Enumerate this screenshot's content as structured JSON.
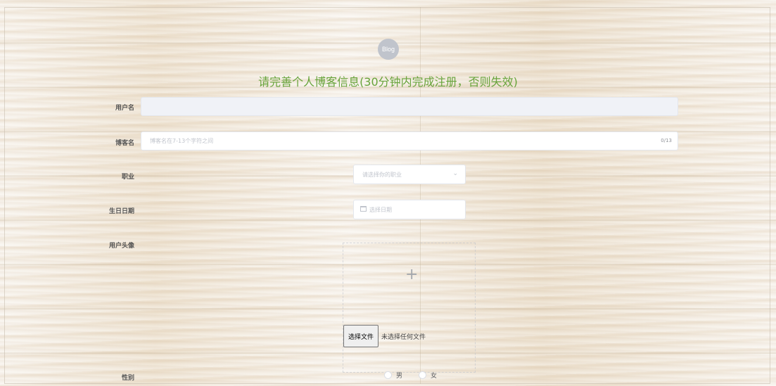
{
  "logo": {
    "text": "Blog"
  },
  "title": "请完善个人博客信息(30分钟内完成注册，否则失效)",
  "form": {
    "username": {
      "label": "用户名",
      "value": ""
    },
    "blogname": {
      "label": "博客名",
      "placeholder": "博客名在7-13个字符之间",
      "counter": "0/13"
    },
    "job": {
      "label": "职业",
      "placeholder": "请选择你的职业",
      "icon": "chevron-down-icon"
    },
    "birthday": {
      "label": "生日日期",
      "placeholder": "选择日期",
      "icon": "calendar-icon"
    },
    "avatar": {
      "label": "用户头像",
      "icon": "plus-icon",
      "file_button": "选择文件",
      "file_status": "未选择任何文件"
    },
    "gender": {
      "label": "性别",
      "options": [
        "男",
        "女"
      ]
    }
  }
}
